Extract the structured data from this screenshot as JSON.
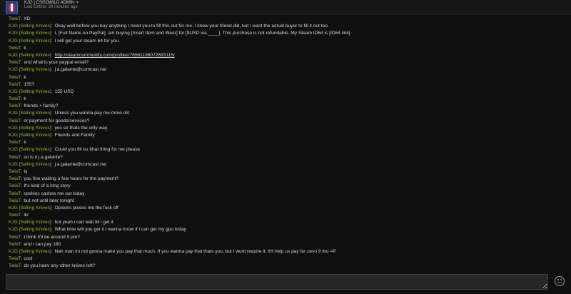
{
  "header": {
    "name": "KJG | CSGOWILD ADMIN",
    "status": "Last Online: 26 minutes ago"
  },
  "messages": [
    {
      "sender": "TwisT:",
      "who": "twist",
      "text": "XD"
    },
    {
      "sender": "KJG [Selling Knives]:",
      "who": "kjg",
      "text": "Okay well before you buy anything I need you to fill this out for me. I know your friend did, but I want the actual buyer to fill it out too."
    },
    {
      "sender": "KJG [Selling Knives]:",
      "who": "kjg",
      "text": "I, [Full Name on PayPal], am buying [Insert Item and Wear] for [$USD via ____]. This purchase is not refundable. My Steam ID64 is [ID64 link]"
    },
    {
      "sender": "KJG [Selling Knives]:",
      "who": "kjg",
      "text": "I will get your steam 64 for you"
    },
    {
      "sender": "TwisT:",
      "who": "twist",
      "text": "k"
    },
    {
      "sender": "KJG [Selling Knives]:",
      "who": "kjg",
      "text": "http://steamcommunity.com/profiles/76561198072693115/",
      "link": true
    },
    {
      "sender": "TwisT:",
      "who": "twist",
      "text": "and what is your paypal email?"
    },
    {
      "sender": "KJG [Selling Knives]:",
      "who": "kjg",
      "text": "j.a.galante@comcast.net"
    },
    {
      "sender": "TwisT:",
      "who": "twist",
      "text": "k"
    },
    {
      "sender": "TwisT:",
      "who": "twist",
      "text": "155?"
    },
    {
      "sender": "KJG [Selling Knives]:",
      "who": "kjg",
      "text": "155 USD"
    },
    {
      "sender": "TwisT:",
      "who": "twist",
      "text": "k"
    },
    {
      "sender": "TwisT:",
      "who": "twist",
      "text": "friends + family?"
    },
    {
      "sender": "KJG [Selling Knives]:",
      "who": "kjg",
      "text": "Unless you wanna pay me more ofc"
    },
    {
      "sender": "TwisT:",
      "who": "twist",
      "text": "or payment for goods/services?"
    },
    {
      "sender": "KJG [Selling Knives]:",
      "who": "kjg",
      "text": "yes sir thats the only way"
    },
    {
      "sender": "KJG [Selling Knives]:",
      "who": "kjg",
      "text": "Friends and Family"
    },
    {
      "sender": "TwisT:",
      "who": "twist",
      "text": "k"
    },
    {
      "sender": "KJG [Selling Knives]:",
      "who": "kjg",
      "text": "Could you fill ou tthat thing for me please"
    },
    {
      "sender": "TwisT:",
      "who": "twist",
      "text": "so is it j.a.galante?"
    },
    {
      "sender": "KJG [Selling Knives]:",
      "who": "kjg",
      "text": "j.a.galante@comcast.net"
    },
    {
      "sender": "TwisT:",
      "who": "twist",
      "text": "ty"
    },
    {
      "sender": "TwisT:",
      "who": "twist",
      "text": "you fine waiting a few hours for the payment?"
    },
    {
      "sender": "TwisT:",
      "who": "twist",
      "text": "It's kind of a long story"
    },
    {
      "sender": "TwisT:",
      "who": "twist",
      "text": "opskins cashes me  out today"
    },
    {
      "sender": "TwisT:",
      "who": "twist",
      "text": "but not until later tonight"
    },
    {
      "sender": "KJG [Selling Knives]:",
      "who": "kjg",
      "text": "Opskins pisses me the fuck off"
    },
    {
      "sender": "TwisT:",
      "who": "twist",
      "text": "ikr"
    },
    {
      "sender": "KJG [Selling Knives]:",
      "who": "kjg",
      "text": "but yeah i can wait till i get it"
    },
    {
      "sender": "KJG [Selling Knives]:",
      "who": "kjg",
      "text": "What time will you get it i wanna know if i can get my gpu today"
    },
    {
      "sender": "TwisT:",
      "who": "twist",
      "text": "I think it'll be around 9 pm?"
    },
    {
      "sender": "TwisT:",
      "who": "twist",
      "text": "and i can pay 180"
    },
    {
      "sender": "KJG [Selling Knives]:",
      "who": "kjg",
      "text": "Nah man im not gonna make you pay that much. If you wanna pay that thats you, but I wont require it. It'll help us pay for cevo 9 tho =P"
    },
    {
      "sender": "TwisT:",
      "who": "twist",
      "text": "cool"
    },
    {
      "sender": "TwisT:",
      "who": "twist",
      "text": "do you haev any other knives left?"
    }
  ],
  "composer": {
    "value": ""
  },
  "icons": {
    "avatar": "nba-logo-avatar",
    "emoji": "emoticon-icon",
    "dropdown": "chevron-down-icon"
  },
  "colors": {
    "kjg": "#8fb938",
    "twist": "#9fc44a",
    "background": "#0f0f0f"
  }
}
